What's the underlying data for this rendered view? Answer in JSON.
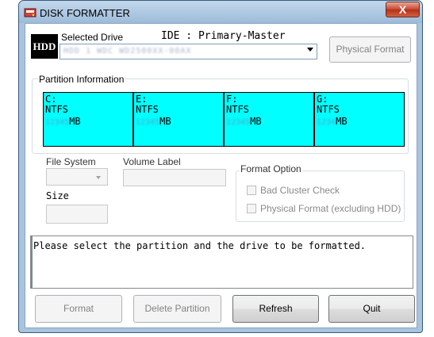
{
  "window": {
    "title": "DISK FORMATTER",
    "close_label": "X"
  },
  "drive": {
    "logo_text": "HDD",
    "selected_drive_label": "Selected Drive",
    "drive_header": "IDE : Primary-Master",
    "drive_value": "HDD 1 WDC WD2500XX-00AX",
    "physical_format_label": "Physical Format"
  },
  "partition_info": {
    "label": "Partition Information",
    "partitions": [
      {
        "letter": "C:",
        "fs": "NTFS",
        "size_blurred": "12345",
        "unit": "MB"
      },
      {
        "letter": "E:",
        "fs": "NTFS",
        "size_blurred": "12345",
        "unit": "MB"
      },
      {
        "letter": "F:",
        "fs": "NTFS",
        "size_blurred": "12345",
        "unit": "MB"
      },
      {
        "letter": "G:",
        "fs": "NTFS",
        "size_blurred": "1234",
        "unit": "MB"
      }
    ]
  },
  "fields": {
    "file_system_label": "File System",
    "volume_label_label": "Volume Label",
    "size_label": "Size"
  },
  "format_option": {
    "label": "Format Option",
    "bad_cluster_check": "Bad Cluster Check",
    "physical_format_excl": "Physical Format (excluding HDD)"
  },
  "message": "Please select the partition and the drive to be formatted.",
  "buttons": {
    "format": "Format",
    "delete_partition": "Delete Partition",
    "refresh": "Refresh",
    "quit": "Quit"
  }
}
